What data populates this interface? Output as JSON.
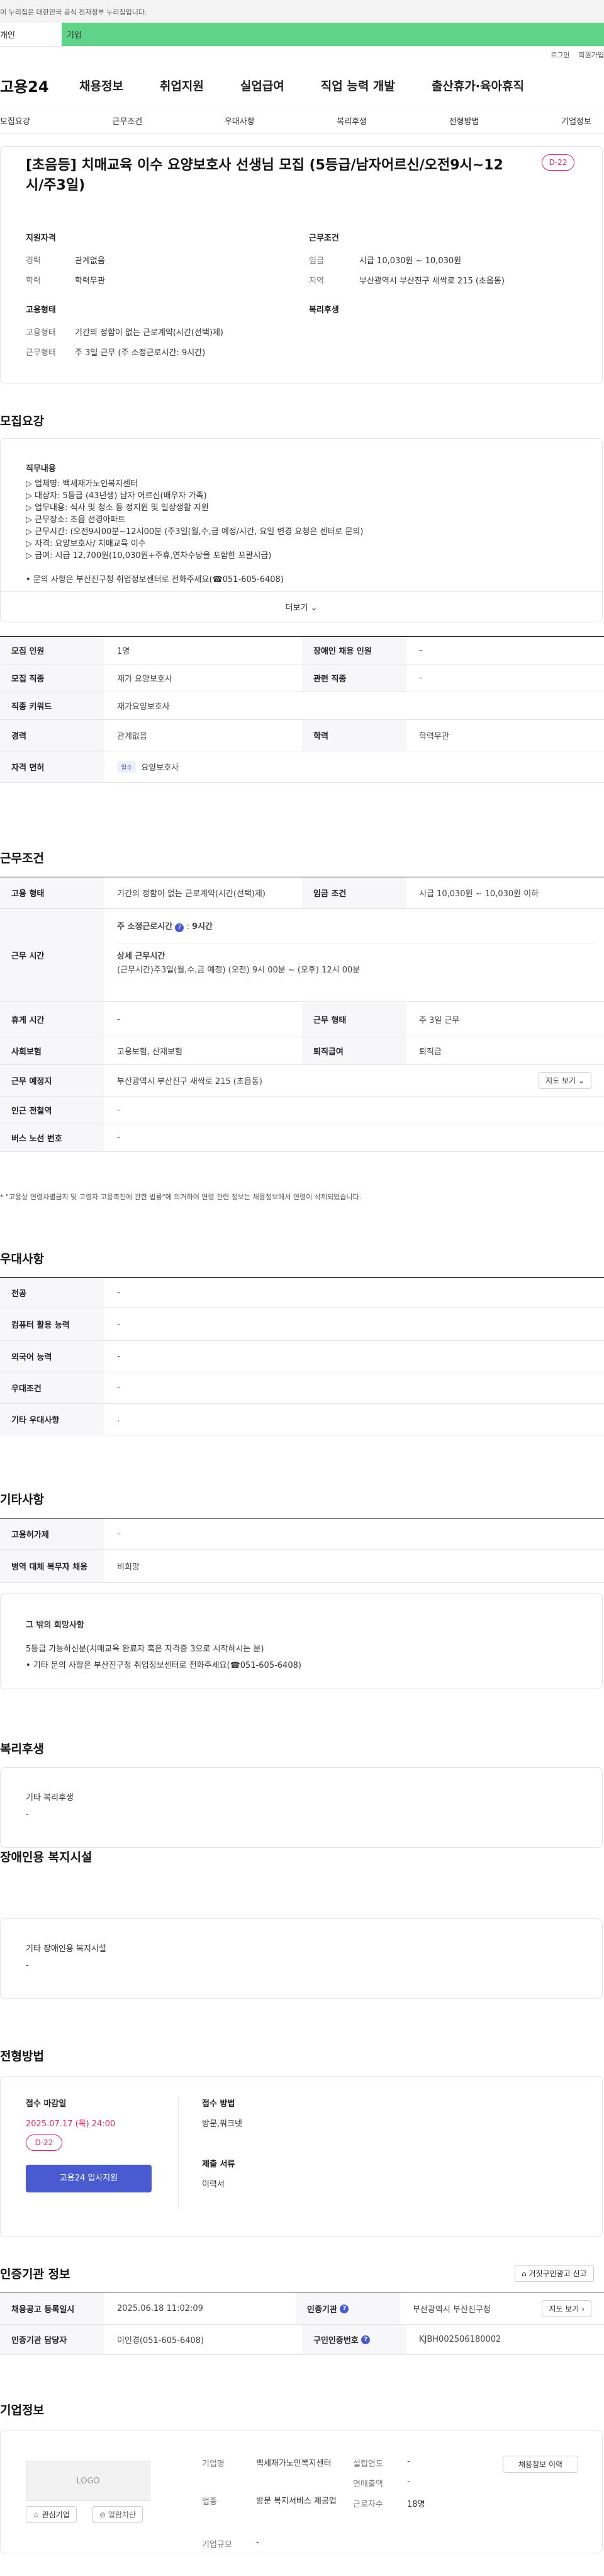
{
  "notice": "이 누리집은 대한민국 공식 전자정부 누리집입니다.",
  "tabs": {
    "personal": "개인",
    "corporate": "기업"
  },
  "util": {
    "login": "로그인",
    "join": "회원가입"
  },
  "logo": "고용24",
  "gnb": [
    "채용정보",
    "취업지원",
    "실업급여",
    "직업 능력 개발",
    "출산휴가·육아휴직"
  ],
  "anchors": [
    "모집요강",
    "근무조건",
    "우대사항",
    "복리후생",
    "전형방법",
    "기업정보"
  ],
  "job": {
    "title": "[초음등] 치매교육 이수 요양보호사 선생님 모집 (5등급/남자어르신/오전9시~12시/주3일)",
    "dday": "D-22",
    "qual_h": "지원자격",
    "cond_h": "근무조건",
    "career_l": "경력",
    "career_v": "관계없음",
    "edu_l": "학력",
    "edu_v": "학력무관",
    "pay_l": "임금",
    "pay_v": "시급 10,030원 ~ 10,030원",
    "region_l": "지역",
    "region_v": "부산광역시 부산진구 새싹로 215 (초읍동)",
    "emp_h": "고용형태",
    "welfare_h": "복리후생",
    "emptype_l": "고용형태",
    "emptype_v": "기간의 정함이 없는 근로계약(시간(선택)제)",
    "worktype_l": "근무형태",
    "worktype_v": "주 3일 근무 (주 소정근로시간: 9시간)"
  },
  "sec_recruit": "모집요강",
  "duty": {
    "heading": "직무내용",
    "lines": [
      "▷ 업체명: 백세재가노인복지센터",
      "▷ 대상자:  5등급 (43년생) 남자 어르신(배우자 가족)",
      "▷ 업무내용: 식사 및 청소 등 정지원 및 일상생활 지원",
      "▷ 근무장소: 초읍 선경아파트",
      "▷ 근무시간:  (오전9시00분~12시00분 (주3일(월,수,금 예정/시간, 요일 변경 요청은 센터로 문의)",
      "▷ 자격: 요양보호사/ 치매교육 이수",
      "▷ 급여: 시급 12,700원(10,030원+주휴,연차수당을 포함한 포괄시급)",
      "",
      "• 문의 사항은 부산진구청 취업정보센터로 전화주세요(☎051-605-6408)"
    ],
    "more": "더보기"
  },
  "recruit_tbl": {
    "count_l": "모집 인원",
    "count_v": "1명",
    "disabled_l": "장애인 채용 인원",
    "disabled_v": "-",
    "job_l": "모집 직종",
    "job_v": "재가 요양보호사",
    "related_l": "관련 직종",
    "related_v": "-",
    "kw_l": "직종 키워드",
    "kw_v": "재가요양보호사",
    "career_l": "경력",
    "career_v": "관계없음",
    "edu_l": "학력",
    "edu_v": "학력무관",
    "license_l": "자격 면허",
    "license_tag": "필수",
    "license_v": "요양보호사"
  },
  "sec_cond": "근무조건",
  "cond_tbl": {
    "emptype_l": "고용 형태",
    "emptype_v": "기간의 정함이 없는 근로계약(시간(선택)제)",
    "wage_l": "임금 조건",
    "wage_v": "시급 10,030원 ~ 10,030원 이하",
    "hours_l": "근무 시간",
    "hours_std_l": "주 소정근로시간",
    "hours_std_v": "9시간",
    "hours_detail_h": "상세 근무시간",
    "hours_detail_v": "(근무시간)주3일(월,수,금 예정) (오전) 9시 00분 ~ (오후) 12시 00분",
    "rest_l": "휴게 시간",
    "rest_v": "-",
    "form_l": "근무 형태",
    "form_v": "주 3일 근무",
    "ins_l": "사회보험",
    "ins_v": "고용보험, 산재보험",
    "retire_l": "퇴직급여",
    "retire_v": "퇴직금",
    "place_l": "근무 예정지",
    "place_v": "부산광역시 부산진구 새싹로 215 (초읍동)",
    "map_btn": "지도 보기",
    "subway_l": "인근 전철역",
    "subway_v": "-",
    "bus_l": "버스 노선 번호",
    "bus_v": "-"
  },
  "cond_note": "* \"고용상 연령차별금지 및 고령자 고용촉진에 관한 법률\"에 의거하여 연령 관련 정보는 채용정보에서 연령이 삭제되었습니다.",
  "sec_pref": "우대사항",
  "pref": [
    {
      "l": "전공",
      "v": "-"
    },
    {
      "l": "컴퓨터 활용 능력",
      "v": "-"
    },
    {
      "l": "외국어 능력",
      "v": "-"
    },
    {
      "l": "우대조건",
      "v": "-"
    },
    {
      "l": "기타 우대사항",
      "v": "."
    }
  ],
  "sec_etc": "기타사항",
  "etc": [
    {
      "l": "고용허가제",
      "v": "-"
    },
    {
      "l": "병역 대체 복무자 채용",
      "v": "비희망"
    }
  ],
  "etc_box": {
    "h": "그 밖의 희망사항",
    "l1": "5등급 가능하신분(치매교육 완료자 혹은 자격증 3으로 시작하시는 분)",
    "l2": "• 기타 문의 사항은 부산진구청 취업정보센터로 전화주세요(☎051-605-6408)"
  },
  "sec_welfare": "복리후생",
  "welfare_box": {
    "h": "기타 복리후생",
    "v": "-"
  },
  "sec_disabled": "장애인용 복지시설",
  "disabled_box": {
    "h": "기타 장애인용 복지시설",
    "v": "-"
  },
  "sec_select": "전형방법",
  "select": {
    "deadline_h": "접수 마감일",
    "deadline_v": "2025.07.17 (목) 24:00",
    "dday": "D-22",
    "apply_btn": "고용24 입사지원",
    "method_h": "접수 방법",
    "method_v": "방문,워크넷",
    "docs_h": "제출 서류",
    "docs_v": "이력서"
  },
  "sec_cert": "인증기관 정보",
  "report_btn": "거짓구인광고 신고",
  "cert": {
    "date_l": "채용공고 등록일시",
    "date_v": "2025.06.18 11:02:09",
    "org_l": "인증기관",
    "org_v": "부산광역시 부산진구청",
    "map_btn": "지도 보기",
    "mgr_l": "인증기관 담당자",
    "mgr_v": "이인경(051-605-6408)",
    "no_l": "구인인증번호",
    "no_v": "KJBH002506180002"
  },
  "sec_company": "기업정보",
  "company": {
    "logo": "LOGO",
    "fav": "관심기업",
    "block": "열람차단",
    "name_l": "기업명",
    "name_v": "백세재가노인복지센터",
    "ind_l": "업종",
    "ind_v": "방문 복지서비스 제공업",
    "size_l": "기업규모",
    "size_v": "-",
    "est_l": "설립연도",
    "est_v": "-",
    "rev_l": "연매출액",
    "rev_v": "-",
    "emp_l": "근로자수",
    "emp_v": "18명",
    "jobs_btn": "채용정보 이력"
  }
}
